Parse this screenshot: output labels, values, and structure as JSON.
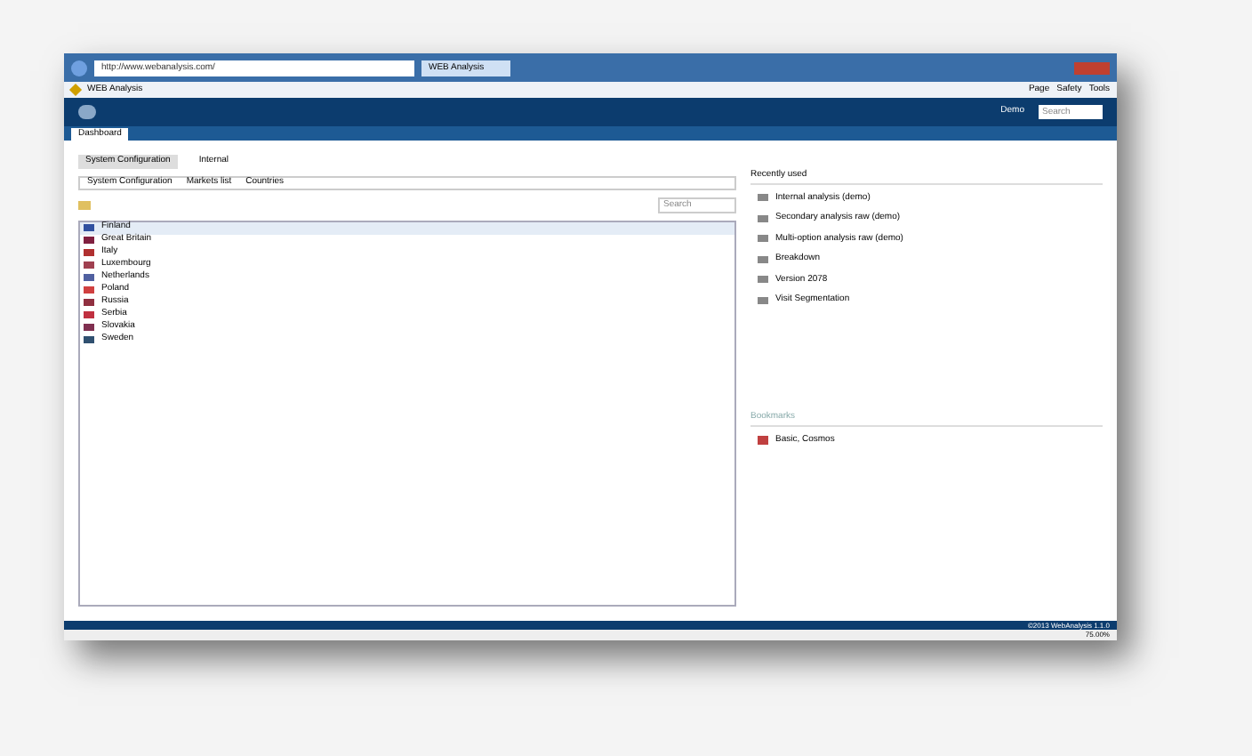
{
  "browser": {
    "address": "http://www.webanalysis.com/",
    "tab_title": "WEB Analysis",
    "favorite": "WEB Analysis",
    "toolbar": [
      "Page",
      "Safety",
      "Tools"
    ]
  },
  "app": {
    "user": "Demo",
    "search": {
      "placeholder": "Search"
    },
    "tabs": [
      {
        "label": "Dashboard",
        "selected": true
      }
    ]
  },
  "main": {
    "tabs": [
      {
        "label": "System Configuration",
        "selected": true
      },
      {
        "label": "Internal",
        "selected": false
      }
    ],
    "breadcrumbs": [
      "System Configuration",
      "Markets list",
      "Countries"
    ],
    "filter": {
      "placeholder": "Search"
    },
    "items": [
      {
        "label": "Finland",
        "selected": true,
        "color": "#3050a0"
      },
      {
        "label": "Great Britain",
        "selected": false,
        "color": "#802040"
      },
      {
        "label": "Italy",
        "selected": false,
        "color": "#b03030"
      },
      {
        "label": "Luxembourg",
        "selected": false,
        "color": "#a04050"
      },
      {
        "label": "Netherlands",
        "selected": false,
        "color": "#5060a0"
      },
      {
        "label": "Poland",
        "selected": false,
        "color": "#d04040"
      },
      {
        "label": "Russia",
        "selected": false,
        "color": "#903040"
      },
      {
        "label": "Serbia",
        "selected": false,
        "color": "#c03040"
      },
      {
        "label": "Slovakia",
        "selected": false,
        "color": "#803050"
      },
      {
        "label": "Sweden",
        "selected": false,
        "color": "#305070"
      }
    ]
  },
  "recently_used": {
    "title": "Recently used",
    "items": [
      "Internal analysis (demo)",
      "Secondary analysis raw (demo)",
      "Multi-option analysis raw (demo)",
      "Breakdown",
      "Version 2078",
      "Visit Segmentation"
    ]
  },
  "bookmarks": {
    "title": "Bookmarks",
    "items": [
      "Basic, Cosmos"
    ]
  },
  "status": {
    "copyright": "©2013 WebAnalysis 1.1.0",
    "zoom": "75.00%"
  }
}
